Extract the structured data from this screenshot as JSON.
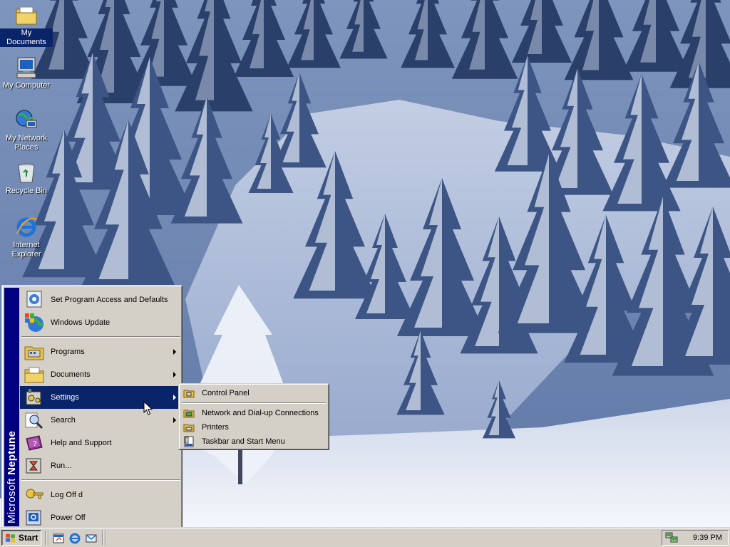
{
  "desktop": {
    "icons": [
      {
        "label": "My Documents",
        "icon": "my-documents-icon",
        "selected": true
      },
      {
        "label": "My Computer",
        "icon": "my-computer-icon"
      },
      {
        "label": "My Network Places",
        "icon": "my-network-places-icon"
      },
      {
        "label": "Recycle Bin",
        "icon": "recycle-bin-icon"
      },
      {
        "label": "Internet Explorer",
        "icon": "internet-explorer-icon"
      }
    ]
  },
  "start_menu": {
    "banner": {
      "part1": "Microsoft ",
      "part2": "Neptune"
    },
    "items": [
      {
        "label": "Set Program Access and Defaults",
        "icon": "program-access-icon",
        "submenu": false
      },
      {
        "label": "Windows Update",
        "icon": "windows-update-icon",
        "submenu": false
      },
      {
        "label": "Programs",
        "icon": "programs-icon",
        "submenu": true
      },
      {
        "label": "Documents",
        "icon": "documents-icon",
        "submenu": true
      },
      {
        "label": "Settings",
        "icon": "settings-icon",
        "submenu": true,
        "active": true
      },
      {
        "label": "Search",
        "icon": "search-icon",
        "submenu": true
      },
      {
        "label": "Help and Support",
        "icon": "help-icon",
        "submenu": false
      },
      {
        "label": "Run...",
        "icon": "run-icon",
        "submenu": false
      },
      {
        "label": "Log Off d",
        "icon": "log-off-icon",
        "submenu": false
      },
      {
        "label": "Power Off",
        "icon": "power-off-icon",
        "submenu": false
      }
    ]
  },
  "settings_submenu": {
    "items": [
      {
        "label": "Control Panel",
        "icon": "control-panel-icon"
      },
      {
        "label": "Network and Dial-up Connections",
        "icon": "network-connections-icon"
      },
      {
        "label": "Printers",
        "icon": "printers-icon"
      },
      {
        "label": "Taskbar and Start Menu",
        "icon": "taskbar-settings-icon"
      }
    ]
  },
  "taskbar": {
    "start_label": "Start",
    "quick_launch": [
      "show-desktop-icon",
      "internet-explorer-icon",
      "outlook-express-icon"
    ],
    "tray_icon": "network-tray-icon",
    "clock": "9:39 PM"
  },
  "colors": {
    "selection": "#0a246a",
    "face": "#d4d0c8",
    "banner": "#000080"
  }
}
